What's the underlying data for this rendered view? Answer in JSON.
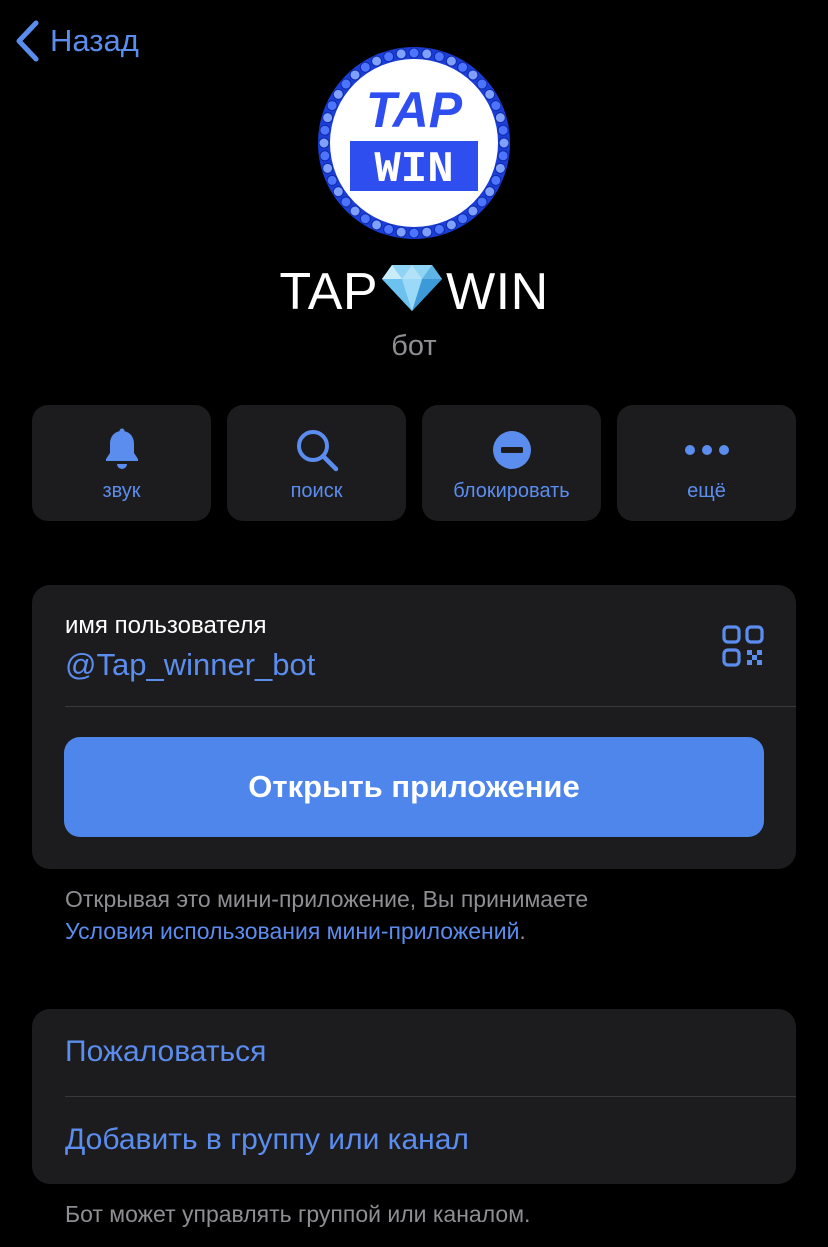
{
  "nav": {
    "back_label": "Назад"
  },
  "profile": {
    "logo_text_top": "TAP",
    "logo_text_bottom": "WIN",
    "name_left": "TAP",
    "name_right": "WIN",
    "subtitle": "бот"
  },
  "actions": [
    {
      "label": "звук",
      "icon": "bell-icon"
    },
    {
      "label": "поиск",
      "icon": "search-icon"
    },
    {
      "label": "блокировать",
      "icon": "block-icon"
    },
    {
      "label": "ещё",
      "icon": "more-icon"
    }
  ],
  "username": {
    "label": "имя пользователя",
    "value": "@Tap_winner_bot",
    "qr_icon": "qr-code-icon"
  },
  "open_app": {
    "label": "Открыть приложение"
  },
  "terms": {
    "text": "Открывая это мини-приложение, Вы принимаете ",
    "link": "Условия использования мини-приложений",
    "suffix": "."
  },
  "menu": {
    "report": "Пожаловаться",
    "add_to_group": "Добавить в группу или канал"
  },
  "footer_note": "Бот может управлять группой или каналом.",
  "colors": {
    "background": "#000000",
    "card": "#1c1c1e",
    "accent": "#5b8def",
    "button": "#4f86ec",
    "secondary_text": "#8e8e93",
    "logo_blue": "#2f4ef0"
  }
}
